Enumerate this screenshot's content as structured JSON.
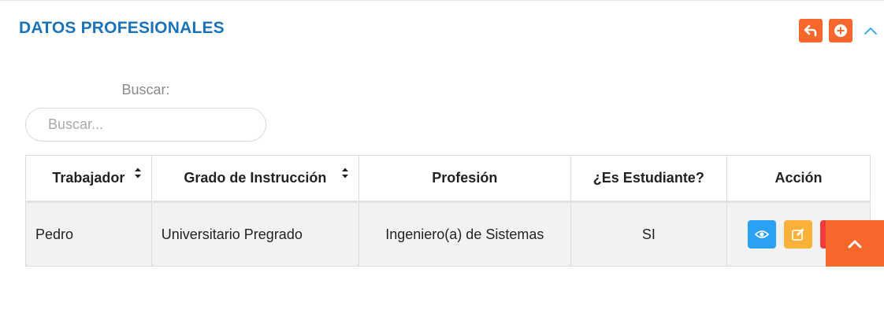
{
  "panel": {
    "title": "DATOS PROFESIONALES",
    "colors": {
      "title": "#1a73b9",
      "tool_button": "#f5672b",
      "collapse_icon": "#2aa1f2"
    },
    "tools": [
      {
        "icon": "reply-icon",
        "label": "Volver"
      },
      {
        "icon": "plus-circle-icon",
        "label": "Agregar"
      },
      {
        "icon": "chevron-up-icon",
        "label": "Colapsar"
      }
    ]
  },
  "search": {
    "label": "Buscar:",
    "placeholder": "Buscar...",
    "value": ""
  },
  "table": {
    "columns": [
      "Trabajador",
      "Grado de Instrucción",
      "Profesión",
      "¿Es Estudiante?",
      "Acción"
    ],
    "sortable": [
      true,
      true,
      false,
      false,
      false
    ],
    "rows": [
      {
        "trabajador": "Pedro",
        "grado": "Universitario Pregrado",
        "profesion": "Ingeniero(a) de Sistemas",
        "estudiante": "SI",
        "actions": [
          {
            "icon": "eye-icon",
            "color": "#2aa1f2"
          },
          {
            "icon": "edit-icon",
            "color": "#f9b13a"
          },
          {
            "icon": "trash-icon",
            "color": "#ef3b3b"
          }
        ]
      }
    ]
  },
  "scroll_top": {
    "icon": "chevron-up-icon",
    "color": "#f5672b"
  }
}
